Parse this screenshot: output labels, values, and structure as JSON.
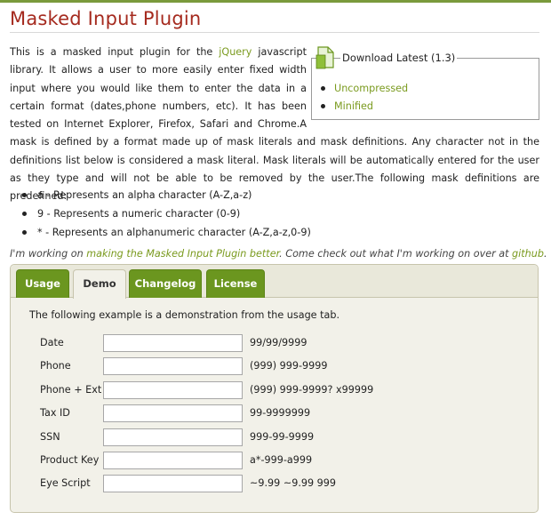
{
  "page": {
    "title": "Masked Input Plugin"
  },
  "download": {
    "legend": "Download Latest (1.3)",
    "links": [
      "Uncompressed",
      "Minified"
    ]
  },
  "intro": {
    "before_link": "This is a masked input plugin for the ",
    "link": "jQuery",
    "after_link": " javascript library. It allows a user to more easily enter fixed width input where you would like them to enter the data in a certain format (dates,phone numbers, etc). It has been tested on Internet Explorer, Firefox, Safari and Chrome.A mask is defined by a format made up of mask literals and mask definitions. Any character not in the definitions list below is considered a mask literal. Mask literals will be automatically entered for the user as they type and will not be able to be removed by the user.The following mask definitions are predefined:"
  },
  "definitions": [
    "a - Represents an alpha character (A-Z,a-z)",
    "9 - Represents a numeric character (0-9)",
    "* - Represents an alphanumeric character (A-Z,a-z,0-9)"
  ],
  "working": {
    "part1": "I'm working on ",
    "link1": "making the Masked Input Plugin better",
    "part2": ". Come check out what I'm working on over at ",
    "link2": "github",
    "part3": "."
  },
  "tabs": [
    {
      "label": "Usage",
      "active": false
    },
    {
      "label": "Demo",
      "active": true
    },
    {
      "label": "Changelog",
      "active": false
    },
    {
      "label": "License",
      "active": false
    }
  ],
  "demo": {
    "intro": "The following example is a demonstration from the usage tab.",
    "fields": [
      {
        "label": "Date",
        "value": "",
        "mask": "99/99/9999"
      },
      {
        "label": "Phone",
        "value": "",
        "mask": "(999) 999-9999"
      },
      {
        "label": "Phone + Ext",
        "value": "",
        "mask": "(999) 999-9999? x99999"
      },
      {
        "label": "Tax ID",
        "value": "",
        "mask": "99-9999999"
      },
      {
        "label": "SSN",
        "value": "",
        "mask": "999-99-9999"
      },
      {
        "label": "Product Key",
        "value": "",
        "mask": "a*-999-a999"
      },
      {
        "label": "Eye Script",
        "value": "",
        "mask": "~9.99 ~9.99 999"
      }
    ]
  },
  "colors": {
    "title": "#a52a1e",
    "link": "#7a9a1e",
    "tab": "#6b961f",
    "panel": "#f2f1e9"
  },
  "icons": {
    "download": "document-icon"
  }
}
